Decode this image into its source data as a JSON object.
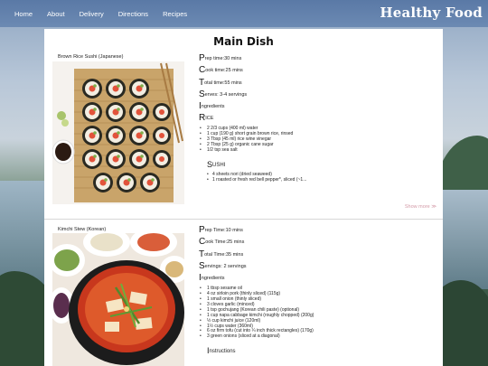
{
  "nav": {
    "links": [
      "Home",
      "About",
      "Delivery",
      "Directions",
      "Recipes"
    ],
    "brand": "Healthy Food"
  },
  "main": {
    "title": "Main Dish"
  },
  "recipes": [
    {
      "name": "Brown Rice Sushi (Japanese)",
      "prep_cap": "P",
      "prep_rest": "rep time:30 mins",
      "cook_cap": "C",
      "cook_rest": "ook time:25 mins",
      "total_cap": "T",
      "total_rest": "otal time:55 mins",
      "serves_cap": "S",
      "serves_rest": "erves: 3-4 servings",
      "ingredients_cap": "I",
      "ingredients_rest": "ngredients",
      "section1_cap": "R",
      "section1_rest": "ICE",
      "section1_items": [
        "2 2/3 cups (400 ml) water",
        "1 cup (190 g) short grain brown rice, rinsed",
        "3 Tbsp (45 ml) rice wine vinegar",
        "2 Tbsp (25 g) organic cane sugar",
        "1/2 tsp sea salt"
      ],
      "section2_cap": "S",
      "section2_rest": "USHI",
      "section2_items": [
        "4 sheets nori (dried seaweed)",
        "1 roasted or fresh red bell pepper*, sliced (~1..."
      ],
      "show_more": "Show more ≫"
    },
    {
      "name": "Kimchi Stew (Korean)",
      "prep_cap": "P",
      "prep_rest": "rep Time:10 mins",
      "cook_cap": "C",
      "cook_rest": "ook Time:25 mins",
      "total_cap": "T",
      "total_rest": "otal Time:35 mins",
      "serves_cap": "S",
      "serves_rest": "ervings: 2 servings",
      "ingredients_cap": "I",
      "ingredients_rest": "ngredients",
      "items": [
        "1 tbsp sesame oil",
        "4 oz sirloin pork (thinly sliced) (115g)",
        "1 small onion (thinly sliced)",
        "3 cloves garlic (minced)",
        "1 tsp gochujang (Korean chili paste) (optional)",
        "1 cup napa cabbage kimchi (roughly chopped) (200g)",
        "½ cup kimchi juice (120ml)",
        "1½ cups water (360ml)",
        "6 oz firm tofu (cut into ¼ inch thick rectangles) (170g)",
        "3 green onions (sliced at a diagonal)"
      ],
      "instructions_cap": "I",
      "instructions_rest": "nstructions"
    }
  ]
}
